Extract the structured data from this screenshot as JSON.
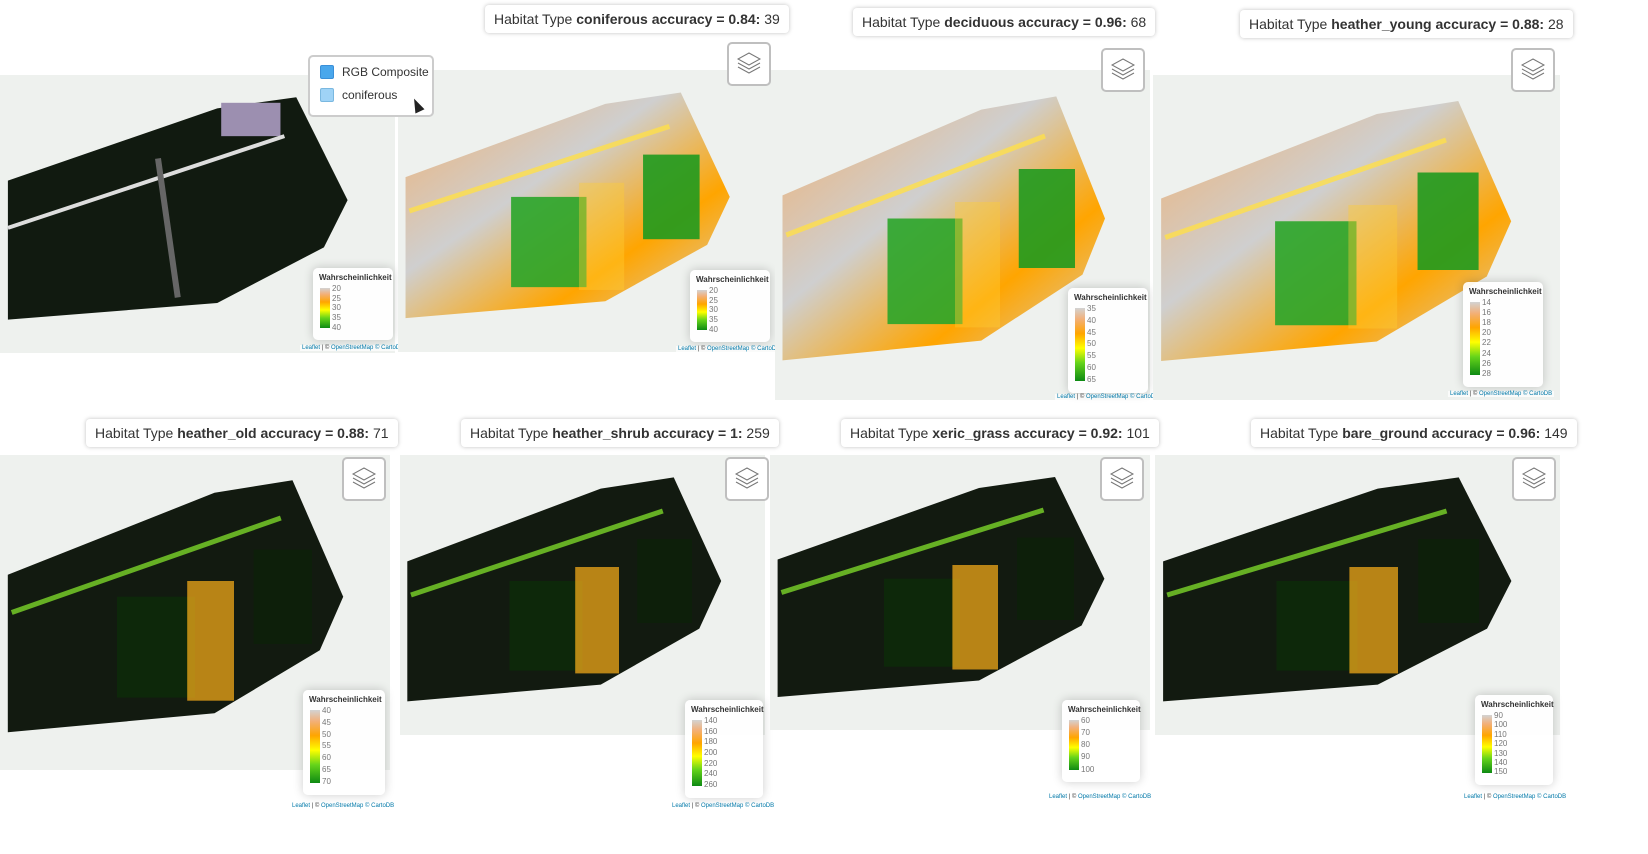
{
  "legend_title": "Wahrscheinlichkeit",
  "attribution": {
    "leaflet": "Leaflet",
    "sep": " | © ",
    "osm": "OpenStreetMap",
    "carto": " © CartoDB"
  },
  "title_prefix": "Habitat Type ",
  "layer_control": {
    "items": [
      "RGB Composite",
      "coniferous"
    ]
  },
  "colors": {
    "low": "#d3d3d3",
    "mid_orange": "#ffa500",
    "mid_yellow": "#ffff00",
    "high": "#0e8a14"
  },
  "panels": [
    {
      "kind": "rgb",
      "title": null,
      "legend_ticks": [
        "20",
        "25",
        "30",
        "35",
        "40"
      ]
    },
    {
      "kind": "prob",
      "habitat": "coniferous",
      "accuracy_label": "accuracy = 0.84:",
      "count": "39",
      "legend_ticks": [
        "20",
        "25",
        "30",
        "35",
        "40"
      ]
    },
    {
      "kind": "prob",
      "habitat": "deciduous",
      "accuracy_label": "accuracy = 0.96:",
      "count": "68",
      "legend_ticks": [
        "35",
        "40",
        "45",
        "50",
        "55",
        "60",
        "65"
      ]
    },
    {
      "kind": "prob",
      "habitat": "heather_young",
      "accuracy_label": "accuracy = 0.88:",
      "count": "28",
      "legend_ticks": [
        "14",
        "16",
        "18",
        "20",
        "22",
        "24",
        "26",
        "28"
      ]
    },
    {
      "kind": "prob",
      "habitat": "heather_old",
      "accuracy_label": "accuracy = 0.88:",
      "count": "71",
      "legend_ticks": [
        "40",
        "45",
        "50",
        "55",
        "60",
        "65",
        "70"
      ]
    },
    {
      "kind": "prob",
      "habitat": "heather_shrub",
      "accuracy_label": "accuracy = 1:",
      "count": "259",
      "legend_ticks": [
        "140",
        "160",
        "180",
        "200",
        "220",
        "240",
        "260"
      ]
    },
    {
      "kind": "prob",
      "habitat": "xeric_grass",
      "accuracy_label": "accuracy = 0.92:",
      "count": "101",
      "legend_ticks": [
        "60",
        "70",
        "80",
        "90",
        "100"
      ]
    },
    {
      "kind": "prob",
      "habitat": "bare_ground",
      "accuracy_label": "accuracy = 0.96:",
      "count": "149",
      "legend_ticks": [
        "90",
        "100",
        "110",
        "120",
        "130",
        "140",
        "150"
      ]
    }
  ]
}
